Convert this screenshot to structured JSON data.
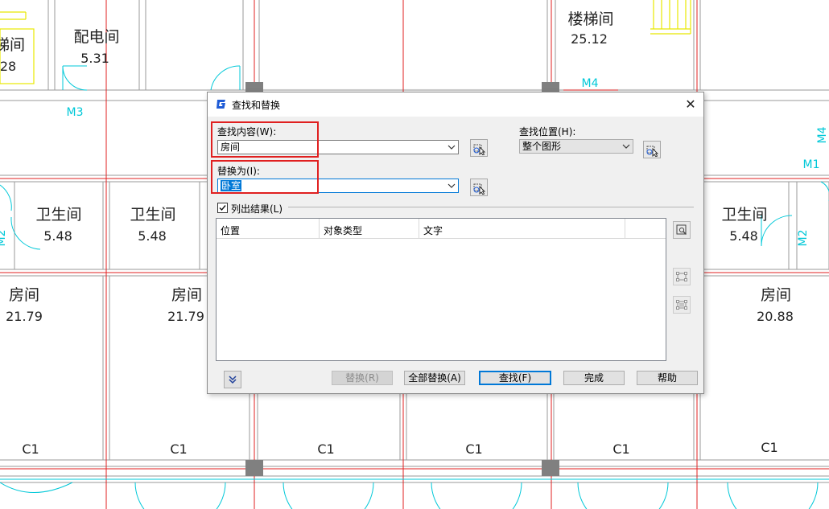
{
  "cad": {
    "rooms": [
      {
        "name": "梯间",
        "area": "28"
      },
      {
        "name": "配电间",
        "area": "5.31"
      },
      {
        "name": "楼梯间",
        "area": "25.12"
      },
      {
        "name": "卫生间",
        "area": "5.48"
      },
      {
        "name": "卫生间",
        "area": "5.48"
      },
      {
        "name": "卫生间",
        "area": "5.48"
      },
      {
        "name": "房间",
        "area": "21.79"
      },
      {
        "name": "房间",
        "area": "21.79"
      },
      {
        "name": "房间",
        "area": "20.88"
      }
    ],
    "door_labels": [
      "M3",
      "M4",
      "M1",
      "M2",
      "M2",
      "M4"
    ],
    "window_labels": [
      "C1",
      "C1",
      "C1",
      "C1",
      "C1",
      "C1"
    ],
    "colors": {
      "wall": "#9a9a9a",
      "axis": "#e02020",
      "door": "#00c8d8",
      "stair": "#e8e800"
    }
  },
  "dialog": {
    "title": "查找和替换",
    "close_glyph": "✕",
    "find": {
      "label": "查找内容(W):",
      "value": "房间"
    },
    "replace": {
      "label": "替换为(I):",
      "value": "卧室"
    },
    "location": {
      "label": "查找位置(H):",
      "value": "整个图形"
    },
    "list_results": {
      "label": "列出结果(L)",
      "checked": true
    },
    "columns": [
      "位置",
      "对象类型",
      "文字"
    ],
    "buttons": {
      "replace": "替换(R)",
      "replace_all": "全部替换(A)",
      "find": "查找(F)",
      "done": "完成",
      "help": "帮助"
    },
    "icons": {
      "app": "app-logo-icon",
      "pick": "select-objects-icon",
      "zoom": "zoom-to-selection-icon",
      "create_set": "create-selection-set-icon",
      "expand": "expand-chevron-icon"
    },
    "colors": {
      "highlight": "#e02020",
      "selection": "#0078d7",
      "logo": "#1e5bd6"
    }
  }
}
